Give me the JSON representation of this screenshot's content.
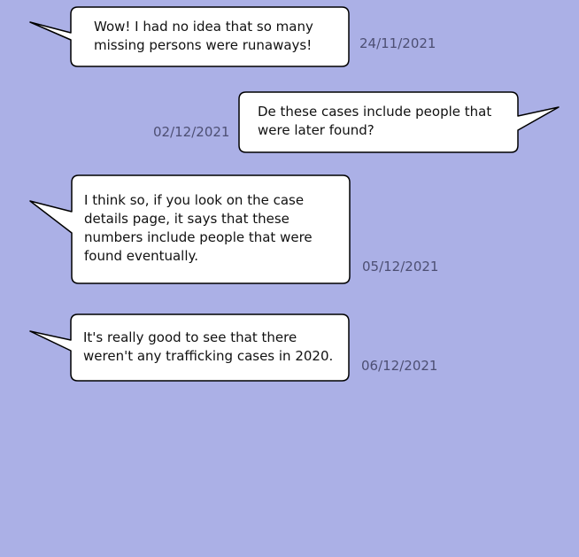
{
  "background_color": "#abb0e6",
  "messages": [
    {
      "text": "Wow! I had no idea that so many missing persons were runaways!",
      "timestamp": "24/11/2021",
      "side": "left"
    },
    {
      "text": "De these cases include people that were later found?",
      "timestamp": "02/12/2021",
      "side": "right"
    },
    {
      "text": "I think so, if you look on the case details page, it says that these numbers include people that were found eventually.",
      "timestamp": "05/12/2021",
      "side": "left"
    },
    {
      "text": "It's really good to see that there weren't any trafficking cases in 2020.",
      "timestamp": "06/12/2021",
      "side": "left"
    }
  ]
}
